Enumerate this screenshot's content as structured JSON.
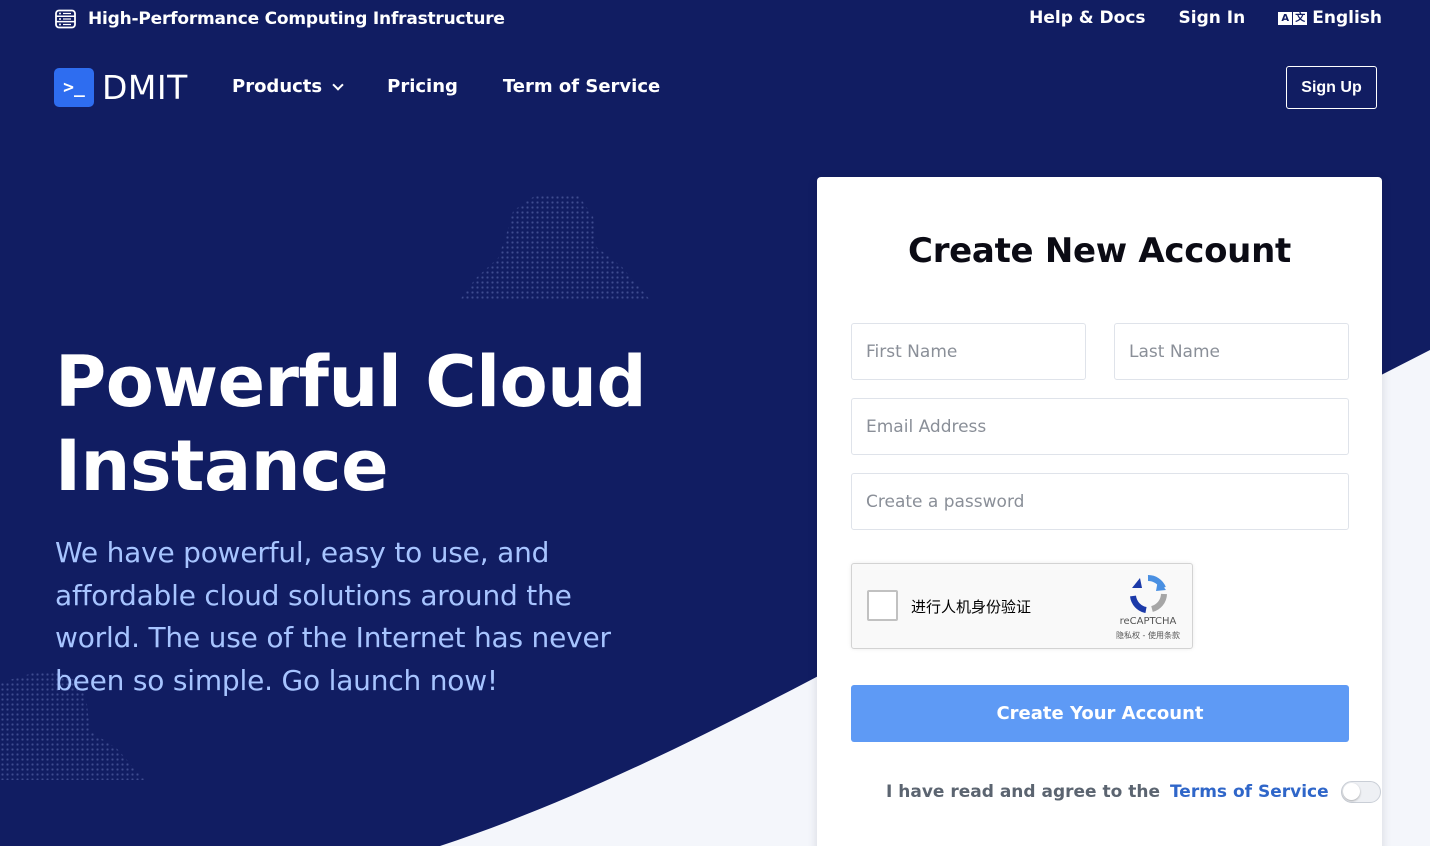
{
  "topbar": {
    "title": "High-Performance Computing Infrastructure",
    "help_docs": "Help & Docs",
    "sign_in": "Sign In",
    "language": "English"
  },
  "nav": {
    "logo_badge": ">_",
    "logo_text": "DMIT",
    "products": "Products",
    "pricing": "Pricing",
    "terms": "Term of Service",
    "sign_up": "Sign Up"
  },
  "hero": {
    "title_line1": "Powerful Cloud",
    "title_line2": "Instance",
    "text": "We have powerful, easy to use, and affordable cloud solutions around the world. The use of the Internet has never been so simple. Go launch now!"
  },
  "form": {
    "title": "Create New Account",
    "first_name_placeholder": "First Name",
    "last_name_placeholder": "Last Name",
    "email_placeholder": "Email Address",
    "password_placeholder": "Create a password",
    "recaptcha": {
      "label": "进行人机身份验证",
      "brand": "reCAPTCHA",
      "links": "隐私权 - 使用条款"
    },
    "submit": "Create Your Account",
    "agree_text": "I have read and agree to the",
    "agree_link": "Terms of Service",
    "agree_checked": false
  },
  "colors": {
    "background": "#111d62",
    "accent": "#2e6df0",
    "button": "#5e9af5",
    "hero_text": "#a7c4ff",
    "curve": "#f4f6fb"
  }
}
